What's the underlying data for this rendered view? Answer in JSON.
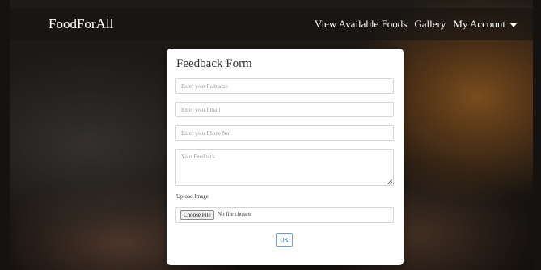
{
  "navbar": {
    "brand": "FoodForAll",
    "links": [
      {
        "label": "View Available Foods"
      },
      {
        "label": "Gallery"
      },
      {
        "label": "My Account"
      }
    ]
  },
  "form": {
    "title": "Feedback Form",
    "fullname_placeholder": "Enter your Fullname",
    "email_placeholder": "Enter your Email",
    "phone_placeholder": "Enter your Phone No.",
    "feedback_placeholder": "Your Feedback",
    "upload_label": "Upload Image",
    "choose_file_label": "Choose File",
    "file_status": "No file chosen",
    "submit_label": "OK"
  },
  "colors": {
    "navbar_text": "#ffffff",
    "submit_border": "#6b9fd6",
    "submit_text": "#1a5fa8"
  },
  "icons": {
    "dropdown": "caret-down-icon",
    "resize": "resize-grip-icon"
  }
}
